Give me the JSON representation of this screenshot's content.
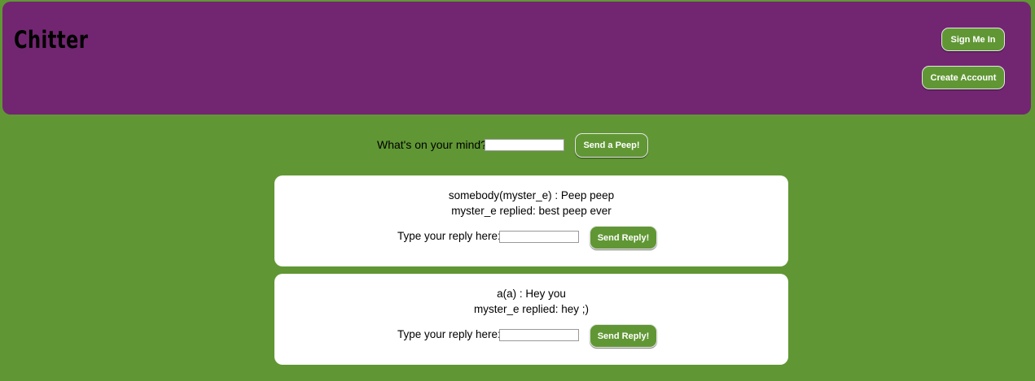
{
  "header": {
    "logo": "Chitter",
    "sign_in_label": "Sign Me In",
    "create_account_label": "Create Account"
  },
  "compose": {
    "label": "What's on your mind?",
    "input_value": "",
    "button_label": "Send a Peep!"
  },
  "peeps": [
    {
      "text": "somebody(myster_e) : Peep peep",
      "reply": "myster_e replied: best peep ever",
      "reply_label": "Type your reply here:",
      "reply_input_value": "",
      "reply_button_label": "Send Reply!"
    },
    {
      "text": "a(a) : Hey you",
      "reply": "myster_e replied: hey ;)",
      "reply_label": "Type your reply here:",
      "reply_input_value": "",
      "reply_button_label": "Send Reply!"
    }
  ],
  "colors": {
    "background": "#609734",
    "header": "#722671",
    "button": "#609734",
    "card": "#ffffff"
  }
}
